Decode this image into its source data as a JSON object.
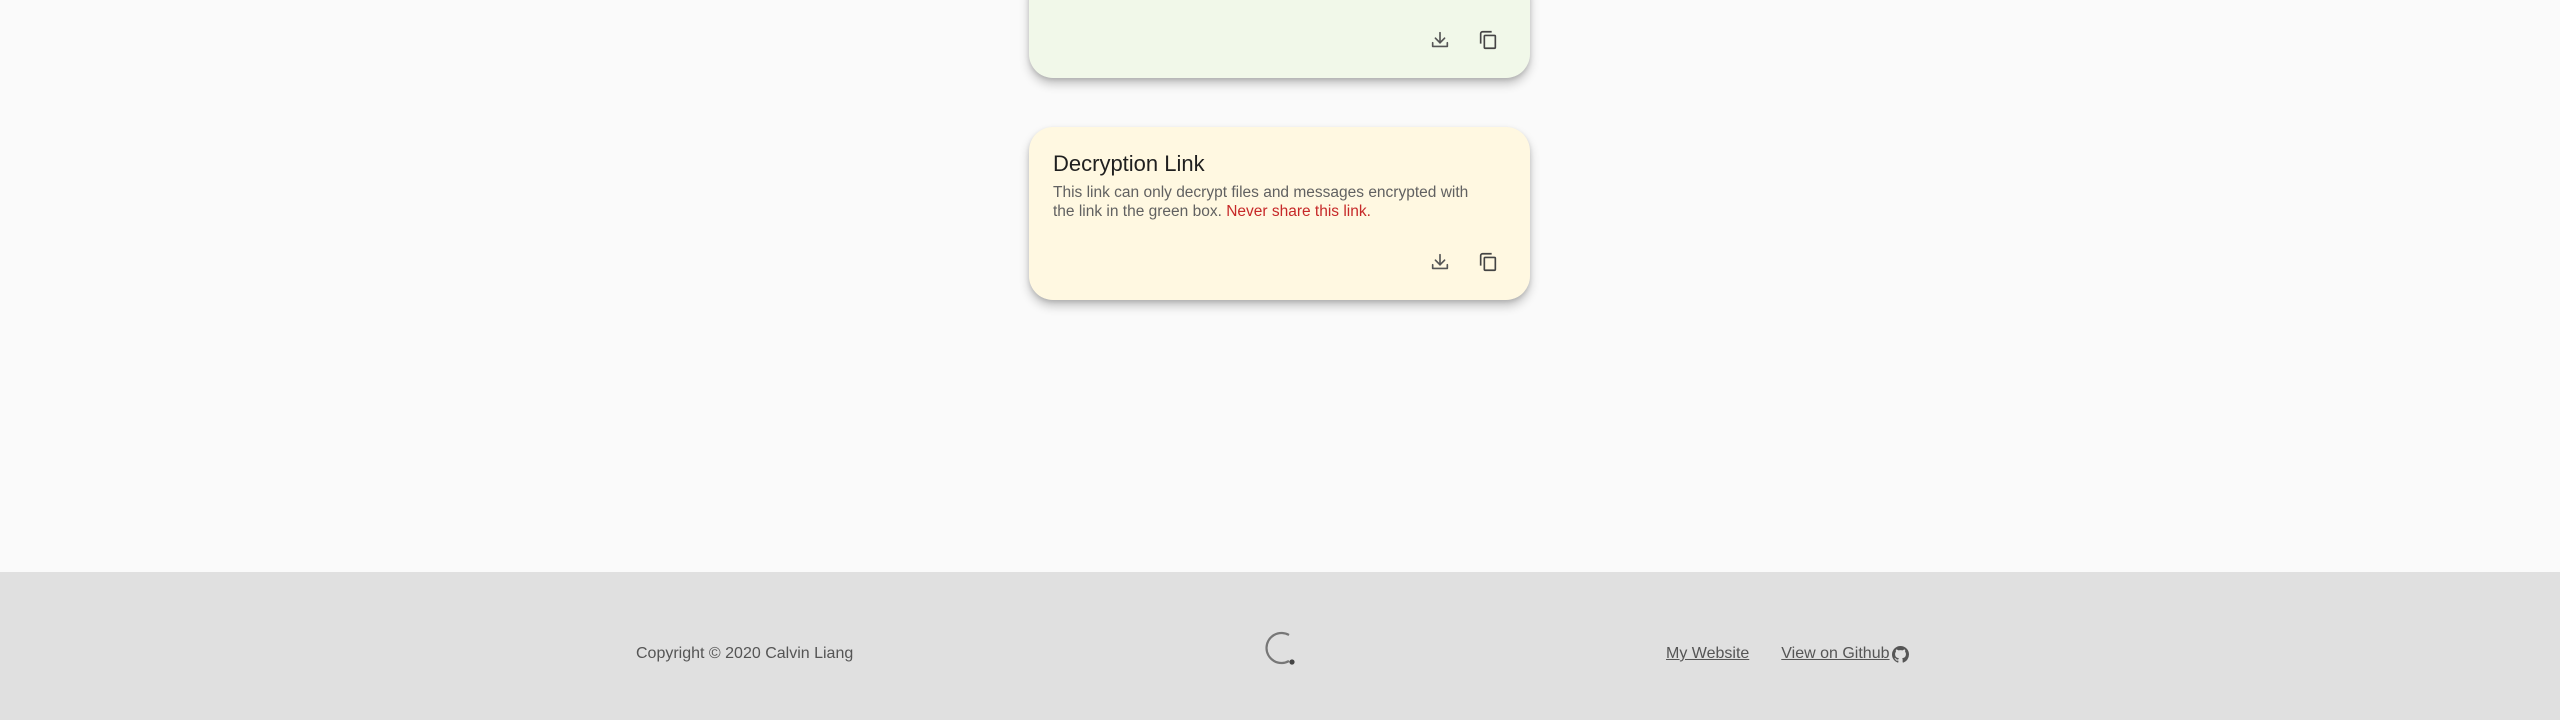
{
  "green_card": {
    "actions": [
      {
        "name": "download-button",
        "icon": "download-icon"
      },
      {
        "name": "copy-button",
        "icon": "copy-icon"
      }
    ]
  },
  "decryption_card": {
    "title": "Decryption Link",
    "description": "This link can only decrypt files and messages encrypted with the link in the green box.",
    "warning": "Never share this link."
  },
  "footer": {
    "copyright": "Copyright © 2020 Calvin Liang",
    "logo_icon": "c-logo-icon",
    "links": {
      "website": "My Website",
      "github": "View on Github"
    }
  },
  "colors": {
    "green_card_bg": "#f1f8e9",
    "yellow_card_bg": "#fff8e1",
    "warning_text": "#c62828",
    "footer_bg": "#e0e0e0"
  }
}
